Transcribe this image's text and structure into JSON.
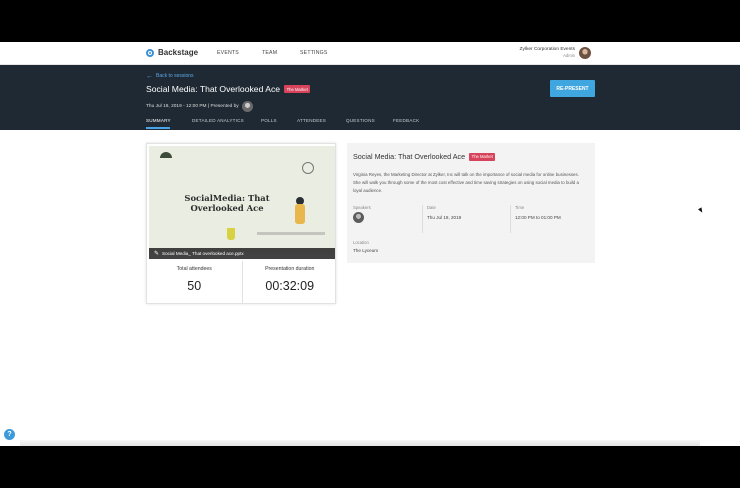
{
  "nav": {
    "brand": "Backstage",
    "links": [
      "EVENTS",
      "TEAM",
      "SETTINGS"
    ],
    "org_name": "Zylker Corporation Events",
    "org_role": "Admin"
  },
  "header": {
    "back_label": "Back to sessions",
    "title": "Social Media: That Overlooked Ace",
    "badge": "The Market",
    "meta": "Thu Jul 18, 2019 - 12:00 PM | Presented by",
    "represent_label": "RE-PRESENT",
    "tabs": [
      "SUMMARY",
      "DETAILED ANALYTICS",
      "POLLS",
      "ATTENDEES",
      "QUESTIONS",
      "FEEDBACK"
    ],
    "active_tab": "SUMMARY"
  },
  "preview": {
    "slide_title": "SocialMedia: That Overlooked Ace",
    "file_name": "Social Media_ That overlooked ace.pptx",
    "stats": [
      {
        "label": "Total attendees",
        "value": "50"
      },
      {
        "label": "Presentation duration",
        "value": "00:32:09"
      }
    ]
  },
  "details": {
    "title": "Social Media: That Overlooked Ace",
    "badge": "The Market",
    "description": "Virginia Reyes, the Marketing Director at Zylker, Inc will talk on the importance of social media for online businesses. She will walk you through some of the most cost effective and time saving strategies on using social media to build a loyal audience.",
    "speakers_label": "Speakers",
    "date_label": "Date",
    "date": "Thu Jul 18, 2019",
    "time_label": "Time",
    "time": "12:00 PM to 01:00 PM",
    "location_label": "Location",
    "location": "The Lyceum"
  },
  "help_glyph": "?",
  "colors": {
    "header_bg": "#1f2933",
    "accent": "#3fa6df",
    "badge": "#d6435b"
  }
}
